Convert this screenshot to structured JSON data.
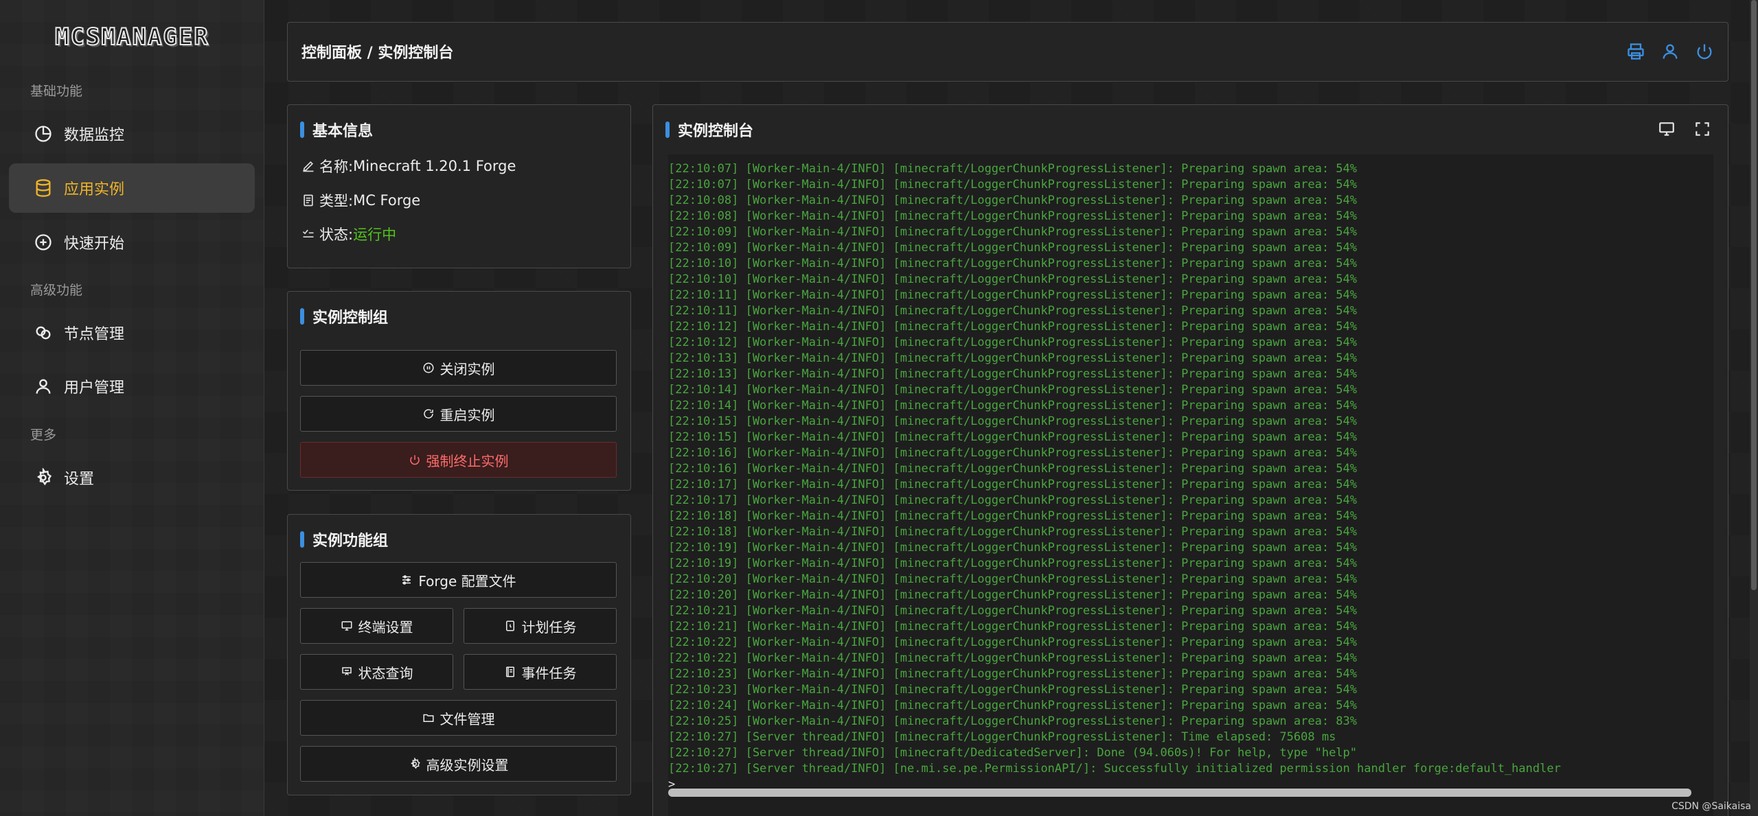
{
  "app": {
    "logo": "MCSMANAGER",
    "watermark": "CSDN @Saikaisa"
  },
  "colors": {
    "accent": "#3b8fe0",
    "active": "#f0b429",
    "running": "#52c41a",
    "danger": "#ff6b6b",
    "log": "#4aa53f"
  },
  "sidebar": {
    "sections": [
      "基础功能",
      "高级功能",
      "更多"
    ],
    "items": [
      {
        "label": "数据监控",
        "icon": "pie-chart-icon"
      },
      {
        "label": "应用实例",
        "icon": "database-icon",
        "active": true
      },
      {
        "label": "快速开始",
        "icon": "plus-circle-icon"
      },
      {
        "label": "节点管理",
        "icon": "nodes-icon"
      },
      {
        "label": "用户管理",
        "icon": "user-icon"
      },
      {
        "label": "设置",
        "icon": "gear-icon"
      }
    ]
  },
  "header": {
    "title": "控制面板 / 实例控制台",
    "icons": [
      "printer-icon",
      "user-icon",
      "power-icon"
    ]
  },
  "info": {
    "title": "基本信息",
    "name_label": "名称: ",
    "name_value": "Minecraft 1.20.1 Forge",
    "type_label": "类型: ",
    "type_value": "MC Forge",
    "status_label": "状态: ",
    "status_value": "运行中"
  },
  "control": {
    "title": "实例控制组",
    "stop": "关闭实例",
    "restart": "重启实例",
    "kill": "强制终止实例"
  },
  "functions": {
    "title": "实例功能组",
    "forge_config": "Forge 配置文件",
    "terminal_settings": "终端设置",
    "scheduled_tasks": "计划任务",
    "status_query": "状态查询",
    "event_tasks": "事件任务",
    "file_manager": "文件管理",
    "advanced_settings": "高级实例设置"
  },
  "console": {
    "title": "实例控制台",
    "prompt": ">",
    "lines": [
      "[22:10:07] [Worker-Main-4/INFO] [minecraft/LoggerChunkProgressListener]: Preparing spawn area: 54%",
      "[22:10:07] [Worker-Main-4/INFO] [minecraft/LoggerChunkProgressListener]: Preparing spawn area: 54%",
      "[22:10:08] [Worker-Main-4/INFO] [minecraft/LoggerChunkProgressListener]: Preparing spawn area: 54%",
      "[22:10:08] [Worker-Main-4/INFO] [minecraft/LoggerChunkProgressListener]: Preparing spawn area: 54%",
      "[22:10:09] [Worker-Main-4/INFO] [minecraft/LoggerChunkProgressListener]: Preparing spawn area: 54%",
      "[22:10:09] [Worker-Main-4/INFO] [minecraft/LoggerChunkProgressListener]: Preparing spawn area: 54%",
      "[22:10:10] [Worker-Main-4/INFO] [minecraft/LoggerChunkProgressListener]: Preparing spawn area: 54%",
      "[22:10:10] [Worker-Main-4/INFO] [minecraft/LoggerChunkProgressListener]: Preparing spawn area: 54%",
      "[22:10:11] [Worker-Main-4/INFO] [minecraft/LoggerChunkProgressListener]: Preparing spawn area: 54%",
      "[22:10:11] [Worker-Main-4/INFO] [minecraft/LoggerChunkProgressListener]: Preparing spawn area: 54%",
      "[22:10:12] [Worker-Main-4/INFO] [minecraft/LoggerChunkProgressListener]: Preparing spawn area: 54%",
      "[22:10:12] [Worker-Main-4/INFO] [minecraft/LoggerChunkProgressListener]: Preparing spawn area: 54%",
      "[22:10:13] [Worker-Main-4/INFO] [minecraft/LoggerChunkProgressListener]: Preparing spawn area: 54%",
      "[22:10:13] [Worker-Main-4/INFO] [minecraft/LoggerChunkProgressListener]: Preparing spawn area: 54%",
      "[22:10:14] [Worker-Main-4/INFO] [minecraft/LoggerChunkProgressListener]: Preparing spawn area: 54%",
      "[22:10:14] [Worker-Main-4/INFO] [minecraft/LoggerChunkProgressListener]: Preparing spawn area: 54%",
      "[22:10:15] [Worker-Main-4/INFO] [minecraft/LoggerChunkProgressListener]: Preparing spawn area: 54%",
      "[22:10:15] [Worker-Main-4/INFO] [minecraft/LoggerChunkProgressListener]: Preparing spawn area: 54%",
      "[22:10:16] [Worker-Main-4/INFO] [minecraft/LoggerChunkProgressListener]: Preparing spawn area: 54%",
      "[22:10:16] [Worker-Main-4/INFO] [minecraft/LoggerChunkProgressListener]: Preparing spawn area: 54%",
      "[22:10:17] [Worker-Main-4/INFO] [minecraft/LoggerChunkProgressListener]: Preparing spawn area: 54%",
      "[22:10:17] [Worker-Main-4/INFO] [minecraft/LoggerChunkProgressListener]: Preparing spawn area: 54%",
      "[22:10:18] [Worker-Main-4/INFO] [minecraft/LoggerChunkProgressListener]: Preparing spawn area: 54%",
      "[22:10:18] [Worker-Main-4/INFO] [minecraft/LoggerChunkProgressListener]: Preparing spawn area: 54%",
      "[22:10:19] [Worker-Main-4/INFO] [minecraft/LoggerChunkProgressListener]: Preparing spawn area: 54%",
      "[22:10:19] [Worker-Main-4/INFO] [minecraft/LoggerChunkProgressListener]: Preparing spawn area: 54%",
      "[22:10:20] [Worker-Main-4/INFO] [minecraft/LoggerChunkProgressListener]: Preparing spawn area: 54%",
      "[22:10:20] [Worker-Main-4/INFO] [minecraft/LoggerChunkProgressListener]: Preparing spawn area: 54%",
      "[22:10:21] [Worker-Main-4/INFO] [minecraft/LoggerChunkProgressListener]: Preparing spawn area: 54%",
      "[22:10:21] [Worker-Main-4/INFO] [minecraft/LoggerChunkProgressListener]: Preparing spawn area: 54%",
      "[22:10:22] [Worker-Main-4/INFO] [minecraft/LoggerChunkProgressListener]: Preparing spawn area: 54%",
      "[22:10:22] [Worker-Main-4/INFO] [minecraft/LoggerChunkProgressListener]: Preparing spawn area: 54%",
      "[22:10:23] [Worker-Main-4/INFO] [minecraft/LoggerChunkProgressListener]: Preparing spawn area: 54%",
      "[22:10:23] [Worker-Main-4/INFO] [minecraft/LoggerChunkProgressListener]: Preparing spawn area: 54%",
      "[22:10:24] [Worker-Main-4/INFO] [minecraft/LoggerChunkProgressListener]: Preparing spawn area: 54%",
      "[22:10:25] [Worker-Main-4/INFO] [minecraft/LoggerChunkProgressListener]: Preparing spawn area: 83%",
      "[22:10:27] [Server thread/INFO] [minecraft/LoggerChunkProgressListener]: Time elapsed: 75608 ms",
      "[22:10:27] [Server thread/INFO] [minecraft/DedicatedServer]: Done (94.060s)! For help, type \"help\"",
      "[22:10:27] [Server thread/INFO] [ne.mi.se.pe.PermissionAPI/]: Successfully initialized permission handler forge:default_handler"
    ]
  }
}
